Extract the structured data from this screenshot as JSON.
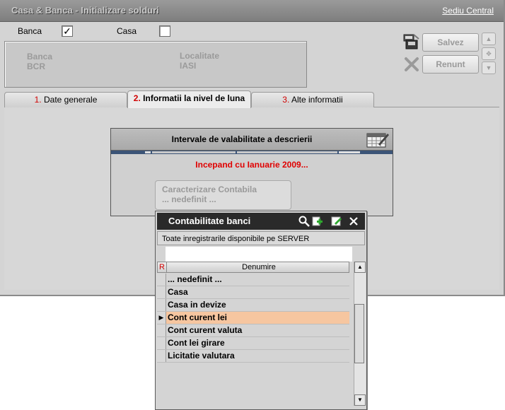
{
  "window": {
    "title": "Casa & Banca - Initializare solduri",
    "company_link": "Sediu Central"
  },
  "filters": {
    "banca_label": "Banca",
    "banca_checked": true,
    "banca_mark": "✓",
    "casa_label": "Casa",
    "casa_checked": false
  },
  "info": {
    "banca_label": "Banca",
    "banca_value": "BCR",
    "localitate_label": "Localitate",
    "localitate_value": "IASI"
  },
  "actions": {
    "save_label": "Salvez",
    "cancel_label": "Renunt",
    "save_icon": "save-print-icon",
    "cancel_icon": "cross-icon",
    "up_glyph": "▲",
    "move_glyph": "✥",
    "down_glyph": "▼"
  },
  "tabs": [
    {
      "num": "1.",
      "label": "Date generale",
      "active": false
    },
    {
      "num": "2.",
      "label": "Informatii la nivel de luna",
      "active": true
    },
    {
      "num": "3.",
      "label": "Alte informatii",
      "active": false
    }
  ],
  "interval": {
    "title": "Intervale de valabilitate a descrierii",
    "since_text": "Incepand cu Ianuarie 2009...",
    "calendar_icon": "calendar-edit-icon"
  },
  "caracterizare": {
    "label": "Caracterizare Contabila",
    "value": "... nedefinit ..."
  },
  "lookup": {
    "title": "Contabilitate banci",
    "server_text": "Toate inregistrarile disponibile pe SERVER",
    "search_value": "",
    "col_r": "R",
    "col_name": "Denumire",
    "selector_glyph": "▶",
    "scroll_up_glyph": "▲",
    "scroll_down_glyph": "▼",
    "rows": [
      {
        "name": "... nedefinit ...",
        "selected": false
      },
      {
        "name": "Casa",
        "selected": false
      },
      {
        "name": "Casa in devize",
        "selected": false
      },
      {
        "name": "Cont curent lei",
        "selected": true
      },
      {
        "name": "Cont curent valuta",
        "selected": false
      },
      {
        "name": "Cont lei girare",
        "selected": false
      },
      {
        "name": "Licitatie valutara",
        "selected": false
      }
    ]
  },
  "colors": {
    "accent_red": "#e00000",
    "selected_row": "#f6c6a0",
    "lookup_title_bg": "#2a2a2a"
  }
}
